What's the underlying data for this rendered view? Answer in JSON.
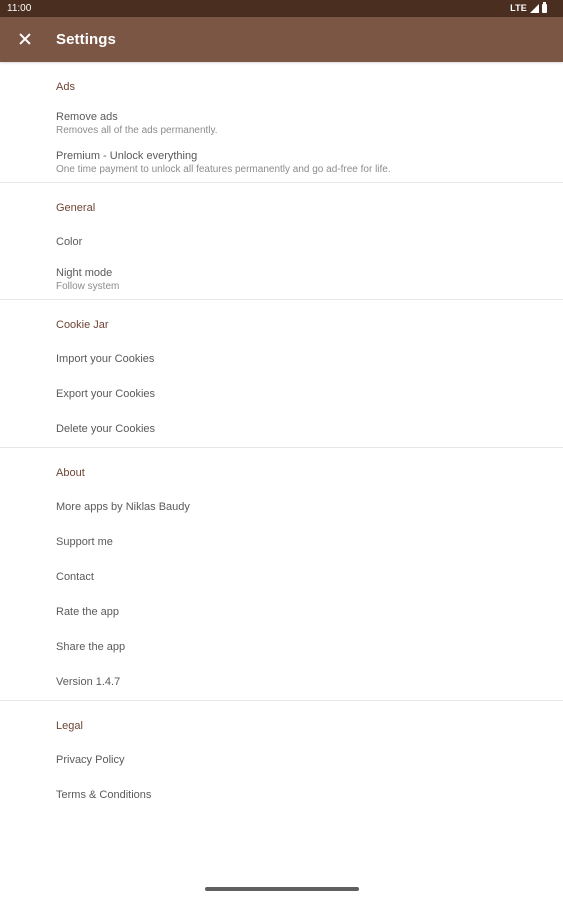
{
  "status_bar": {
    "time": "11:00",
    "network": "LTE",
    "icons": [
      "signal-icon",
      "battery-icon"
    ]
  },
  "app_bar": {
    "title": "Settings",
    "nav_icon": "close-icon",
    "color": "#7b5645"
  },
  "theme": {
    "status_bar_color": "#4a2e20",
    "accent": "#6e4535"
  },
  "sections": [
    {
      "header": "Ads",
      "items": [
        {
          "title": "Remove ads",
          "summary": "Removes all of the ads permanently."
        },
        {
          "title": "Premium - Unlock everything",
          "summary": "One time payment to unlock all features permanently and go ad-free for life."
        }
      ]
    },
    {
      "header": "General",
      "items": [
        {
          "title": "Color"
        },
        {
          "title": "Night mode",
          "summary": "Follow system"
        }
      ]
    },
    {
      "header": "Cookie Jar",
      "items": [
        {
          "title": "Import your Cookies"
        },
        {
          "title": "Export your Cookies"
        },
        {
          "title": "Delete your Cookies"
        }
      ]
    },
    {
      "header": "About",
      "items": [
        {
          "title": "More apps by Niklas Baudy"
        },
        {
          "title": "Support me"
        },
        {
          "title": "Contact"
        },
        {
          "title": "Rate the app"
        },
        {
          "title": "Share the app"
        },
        {
          "title": "Version 1.4.7"
        }
      ]
    },
    {
      "header": "Legal",
      "items": [
        {
          "title": "Privacy Policy"
        },
        {
          "title": "Terms & Conditions"
        }
      ]
    }
  ]
}
